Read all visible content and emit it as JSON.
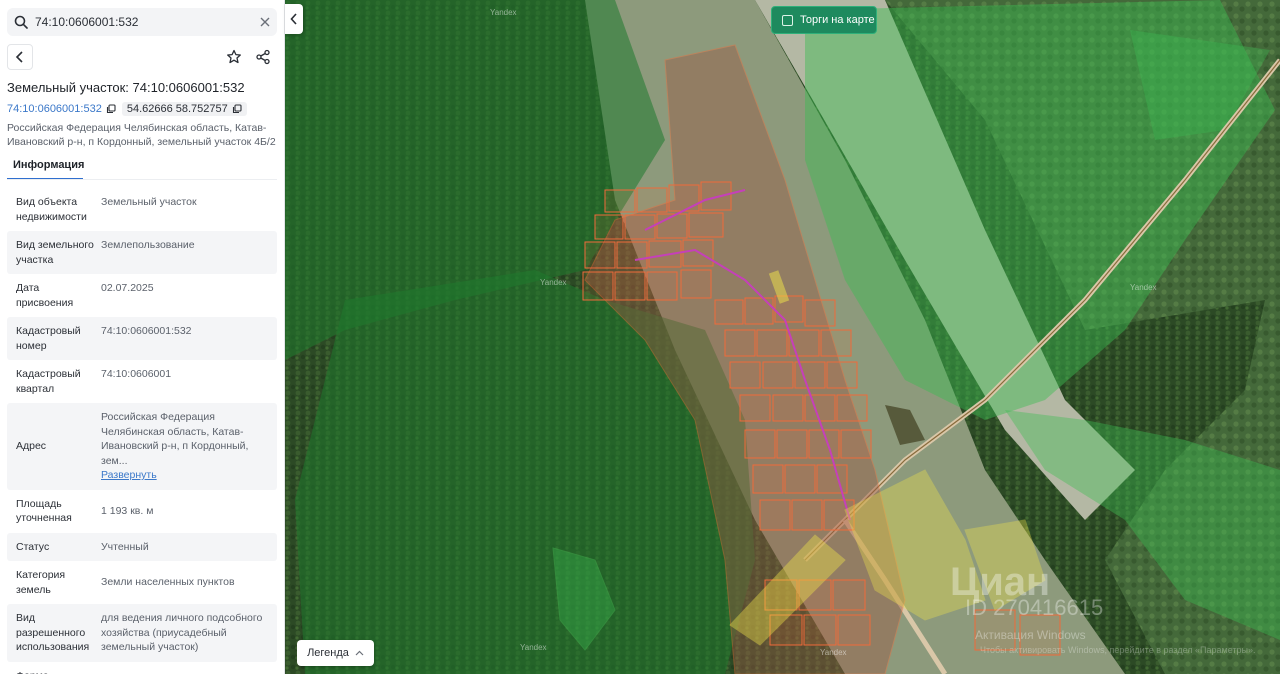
{
  "search": {
    "value": "74:10:0606001:532"
  },
  "parcel": {
    "title": "Земельный участок: 74:10:0606001:532",
    "cadastral_link": "74:10:0606001:532",
    "coordinates": "54.62666 58.752757",
    "address_line": "Российская Федерация Челябинская область, Катав-Ивановский р-н, п Кордонный, земельный участок 4Б/2"
  },
  "tabs": [
    {
      "label": "Информация"
    }
  ],
  "info_rows": [
    {
      "key": "Вид объекта недвижимости",
      "value": "Земельный участок"
    },
    {
      "key": "Вид земельного участка",
      "value": "Землепользование"
    },
    {
      "key": "Дата присвоения",
      "value": "02.07.2025"
    },
    {
      "key": "Кадастровый номер",
      "value": "74:10:0606001:532"
    },
    {
      "key": "Кадастровый квартал",
      "value": "74:10:0606001"
    },
    {
      "key": "Адрес",
      "value": "Российская Федерация Челябинская область, Катав-Ивановский р-н, п Кордонный, зем...",
      "link": "Развернуть"
    },
    {
      "key": "Площадь уточненная",
      "value": "1 193 кв. м"
    },
    {
      "key": "Статус",
      "value": "Учтенный"
    },
    {
      "key": "Категория земель",
      "value": "Земли населенных пунктов"
    },
    {
      "key": "Вид разрешенного использования",
      "value": "для ведения личного подсобного хозяйства (приусадебный земельный участок)"
    },
    {
      "key": "Форма",
      "value": ""
    }
  ],
  "map": {
    "trade_toggle_label": "Торги на карте",
    "legend_label": "Легенда",
    "watermark": "Циан",
    "watermark_id": "ID 270416615",
    "yandex_labels": [
      "Yandex",
      "Yandex",
      "Yandex",
      "Yandex",
      "Yandex"
    ],
    "windows_activation_title": "Активация Windows",
    "windows_activation_text": "Чтобы активировать Windows, перейдите в раздел «Параметры»."
  },
  "colors": {
    "accent": "#1e8a5e",
    "link": "#3b78c9",
    "forest_overlay": "#2ea24a",
    "parcel_outline": "#f06a3a",
    "parcel_selected": "#f2e64a",
    "street_line": "#c540b9"
  }
}
